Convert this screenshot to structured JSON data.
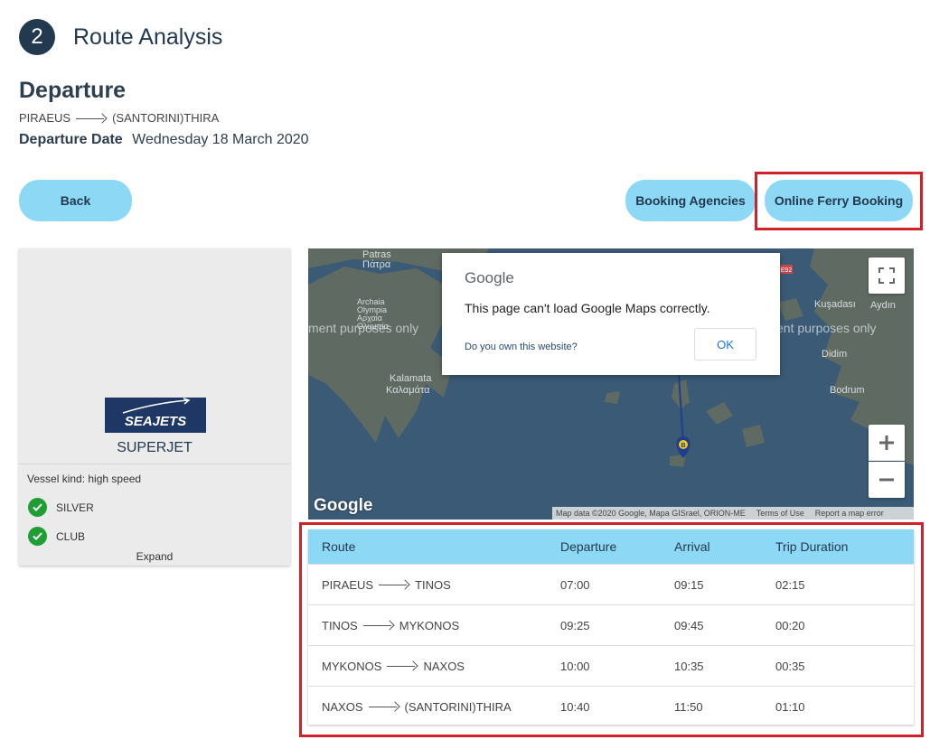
{
  "header": {
    "step_number": "2",
    "step_title": "Route Analysis"
  },
  "departure": {
    "title": "Departure",
    "from": "PIRAEUS",
    "to": "(SANTORINI)THIRA",
    "date_label": "Departure Date",
    "date_value": "Wednesday 18 March 2020"
  },
  "buttons": {
    "back": "Back",
    "booking_agencies": "Booking Agencies",
    "online_ferry_booking": "Online Ferry Booking"
  },
  "vessel": {
    "logo_text": "SEAJETS",
    "name": "SUPERJET",
    "kind": "Vessel kind: high speed",
    "classes": [
      "SILVER",
      "CLUB"
    ],
    "expand_label": "Expand"
  },
  "map": {
    "dev_watermark_left": "ment purposes only",
    "dev_watermark_right": "ent purposes only",
    "labels": {
      "patras": "Patras",
      "patras_gr": "Πάτρα",
      "archaia_olympia": "Archaia",
      "archaia_olympia_2": "Olympia",
      "archaia_olympia_gr": "Αρχαία",
      "archaia_olympia_gr2": "Ολυμπία",
      "kalamata": "Kalamata",
      "kalamata_gr": "Καλαμάτα",
      "kusadasi": "Kuşadası",
      "aydin": "Aydın",
      "didim": "Didim",
      "bodrum": "Bodrum",
      "road_badge": "E92"
    },
    "dialog": {
      "brand": "Google",
      "message": "This page can't load Google Maps correctly.",
      "own_website": "Do you own this website?",
      "ok": "OK"
    },
    "google_logo": "Google",
    "attribution": {
      "data": "Map data ©2020 Google, Mapa GISrael, ORION-ME",
      "terms": "Terms of Use",
      "report": "Report a map error"
    },
    "marker_b_label": "B"
  },
  "schedule": {
    "headers": [
      "Route",
      "Departure",
      "Arrival",
      "Trip Duration"
    ],
    "rows": [
      {
        "from": "PIRAEUS",
        "to": "TINOS",
        "departure": "07:00",
        "arrival": "09:15",
        "duration": "02:15"
      },
      {
        "from": "TINOS",
        "to": "MYKONOS",
        "departure": "09:25",
        "arrival": "09:45",
        "duration": "00:20"
      },
      {
        "from": "MYKONOS",
        "to": "NAXOS",
        "departure": "10:00",
        "arrival": "10:35",
        "duration": "00:35"
      },
      {
        "from": "NAXOS",
        "to": "(SANTORINI)THIRA",
        "departure": "10:40",
        "arrival": "11:50",
        "duration": "01:10"
      }
    ]
  },
  "colors": {
    "accent": "#8cd8f5",
    "dark": "#22394f",
    "highlight": "#d0202a",
    "check": "#1f9e34"
  }
}
